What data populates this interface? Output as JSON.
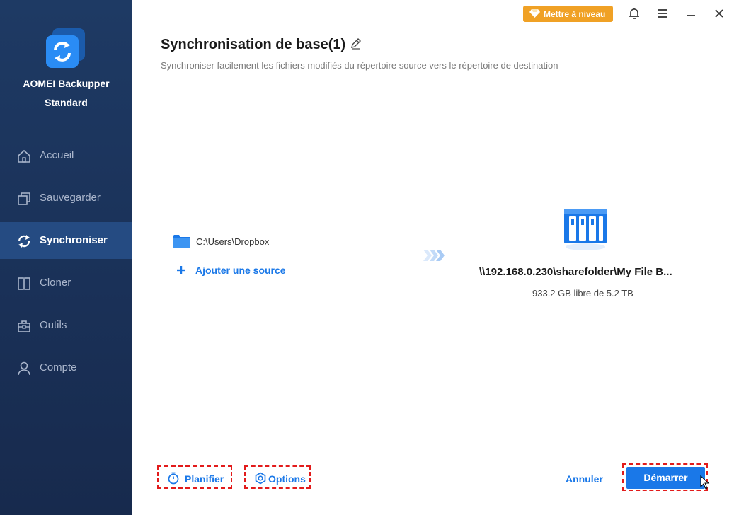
{
  "app": {
    "name_line1": "AOMEI Backupper",
    "name_line2": "Standard"
  },
  "sidebar": {
    "items": [
      {
        "label": "Accueil",
        "icon": "home-icon",
        "active": false
      },
      {
        "label": "Sauvegarder",
        "icon": "backup-icon",
        "active": false
      },
      {
        "label": "Synchroniser",
        "icon": "sync-icon",
        "active": true
      },
      {
        "label": "Cloner",
        "icon": "clone-icon",
        "active": false
      },
      {
        "label": "Outils",
        "icon": "toolbox-icon",
        "active": false
      },
      {
        "label": "Compte",
        "icon": "user-icon",
        "active": false
      }
    ]
  },
  "header": {
    "upgrade_label": "Mettre à niveau",
    "upgrade_icon": "diamond-icon",
    "window_controls": [
      "bell-icon",
      "menu-icon",
      "minimize-icon",
      "close-icon"
    ]
  },
  "page": {
    "title": "Synchronisation de base(1)",
    "subtitle": "Synchroniser facilement les fichiers modifiés du répertoire source vers le répertoire de destination"
  },
  "source": {
    "path": "C:\\Users\\Dropbox",
    "add_label": "Ajouter une source"
  },
  "destination": {
    "path": "\\\\192.168.0.230\\sharefolder\\My File B...",
    "space": "933.2 GB libre de 5.2 TB"
  },
  "actions": {
    "schedule_label": "Planifier",
    "options_label": "Options",
    "cancel_label": "Annuler",
    "start_label": "Démarrer"
  },
  "colors": {
    "sidebar_bg": "#1b3359",
    "sidebar_active": "#254b82",
    "accent": "#1a78e8",
    "upgrade": "#f0a125",
    "highlight_dash": "#e21b1b"
  }
}
